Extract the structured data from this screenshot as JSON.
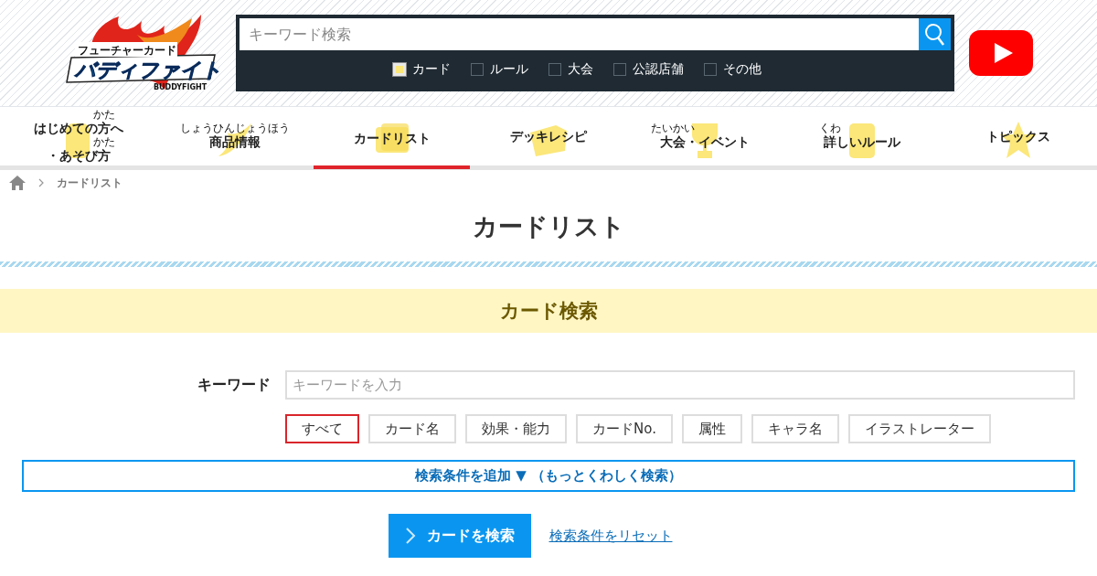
{
  "header": {
    "logo": {
      "subtitle": "フューチャーカード",
      "title": "バディファイト",
      "latin": "BUDDYFIGHT"
    },
    "search": {
      "placeholder": "キーワード検索"
    },
    "categories": [
      {
        "label": "カード",
        "checked": true
      },
      {
        "label": "ルール",
        "checked": false
      },
      {
        "label": "大会",
        "checked": false
      },
      {
        "label": "公認店舗",
        "checked": false
      },
      {
        "label": "その他",
        "checked": false
      }
    ]
  },
  "nav": [
    {
      "kind": "beginner",
      "selected": false,
      "lines": [
        [
          {
            "text": "はじめての"
          },
          {
            "text": "方",
            "ruby": "かた"
          },
          {
            "text": "へ"
          }
        ],
        [
          {
            "text": "・あそび"
          },
          {
            "text": "方",
            "ruby": "かた"
          }
        ]
      ]
    },
    {
      "kind": "products",
      "selected": false,
      "lines": [
        [
          {
            "text": "商品情報",
            "ruby": "しょうひんじょうほう"
          }
        ]
      ]
    },
    {
      "kind": "cards",
      "selected": true,
      "lines": [
        [
          {
            "text": "カードリスト"
          }
        ]
      ]
    },
    {
      "kind": "decks",
      "selected": false,
      "lines": [
        [
          {
            "text": "デッキレシピ"
          }
        ]
      ]
    },
    {
      "kind": "events",
      "selected": false,
      "lines": [
        [
          {
            "text": "大会",
            "ruby": "たいかい"
          },
          {
            "text": "・イベント"
          }
        ]
      ]
    },
    {
      "kind": "rules",
      "selected": false,
      "lines": [
        [
          {
            "text": "詳",
            "ruby": "くわ"
          },
          {
            "text": "しいルール"
          }
        ]
      ]
    },
    {
      "kind": "topics",
      "selected": false,
      "lines": [
        [
          {
            "text": "トピックス"
          }
        ]
      ]
    }
  ],
  "breadcrumb": [
    "カードリスト"
  ],
  "page_title": "カードリスト",
  "section_title": "カード検索",
  "keyword": {
    "label": "キーワード",
    "placeholder": "キーワードを入力"
  },
  "targets": [
    {
      "label": "すべて",
      "selected": true
    },
    {
      "label": "カード名",
      "selected": false
    },
    {
      "label": "効果・能力",
      "selected": false
    },
    {
      "label": "カードNo.",
      "selected": false
    },
    {
      "label": "属性",
      "selected": false
    },
    {
      "label": "キャラ名",
      "selected": false
    },
    {
      "label": "イラストレーター",
      "selected": false
    }
  ],
  "more_conditions": "検索条件を追加 ▼ （もっとくわしく検索）",
  "submit": "カードを検索",
  "reset": "検索条件をリセット"
}
